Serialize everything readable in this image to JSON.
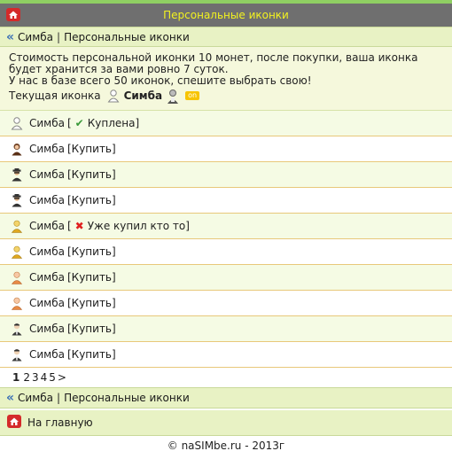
{
  "header": {
    "title": "Персональные иконки"
  },
  "breadcrumb": {
    "user": "Симба",
    "sep": "|",
    "page": "Персональные иконки"
  },
  "info": {
    "line1": "Стоимость персональной иконки 10 монет, после покупки, ваша иконка будет хранится за вами ровно 7 суток.",
    "line2": "У нас в базе всего 50 иконок, спешите выбрать свою!",
    "current_label": "Текущая иконка",
    "current_user": "Симба",
    "on_badge": "on"
  },
  "rows": [
    {
      "name": "Симба",
      "status": "Куплена",
      "state": "bought",
      "icon": "white-user-icon"
    },
    {
      "name": "Симба",
      "status": "Купить",
      "state": "buy",
      "icon": "brown-hair-user-icon"
    },
    {
      "name": "Симба",
      "status": "Купить",
      "state": "buy",
      "icon": "spy-user-icon"
    },
    {
      "name": "Симба",
      "status": "Купить",
      "state": "buy",
      "icon": "spy-user-icon"
    },
    {
      "name": "Симба",
      "status": "Уже купил кто то",
      "state": "taken",
      "icon": "yellow-user-icon"
    },
    {
      "name": "Симба",
      "status": "Купить",
      "state": "buy",
      "icon": "yellow-user-icon"
    },
    {
      "name": "Симба",
      "status": "Купить",
      "state": "buy",
      "icon": "orange-user-icon"
    },
    {
      "name": "Симба",
      "status": "Купить",
      "state": "buy",
      "icon": "orange-user-icon"
    },
    {
      "name": "Симба",
      "status": "Купить",
      "state": "buy",
      "icon": "dark-user-icon"
    },
    {
      "name": "Симба",
      "status": "Купить",
      "state": "buy",
      "icon": "dark-user-icon"
    }
  ],
  "pager": {
    "current": "1",
    "pages": [
      "2",
      "3",
      "4",
      "5"
    ],
    "next": ">"
  },
  "nav": {
    "home_label": "На главную"
  },
  "footer": {
    "copyright": "© naSIMbe.ru - 2013г"
  }
}
